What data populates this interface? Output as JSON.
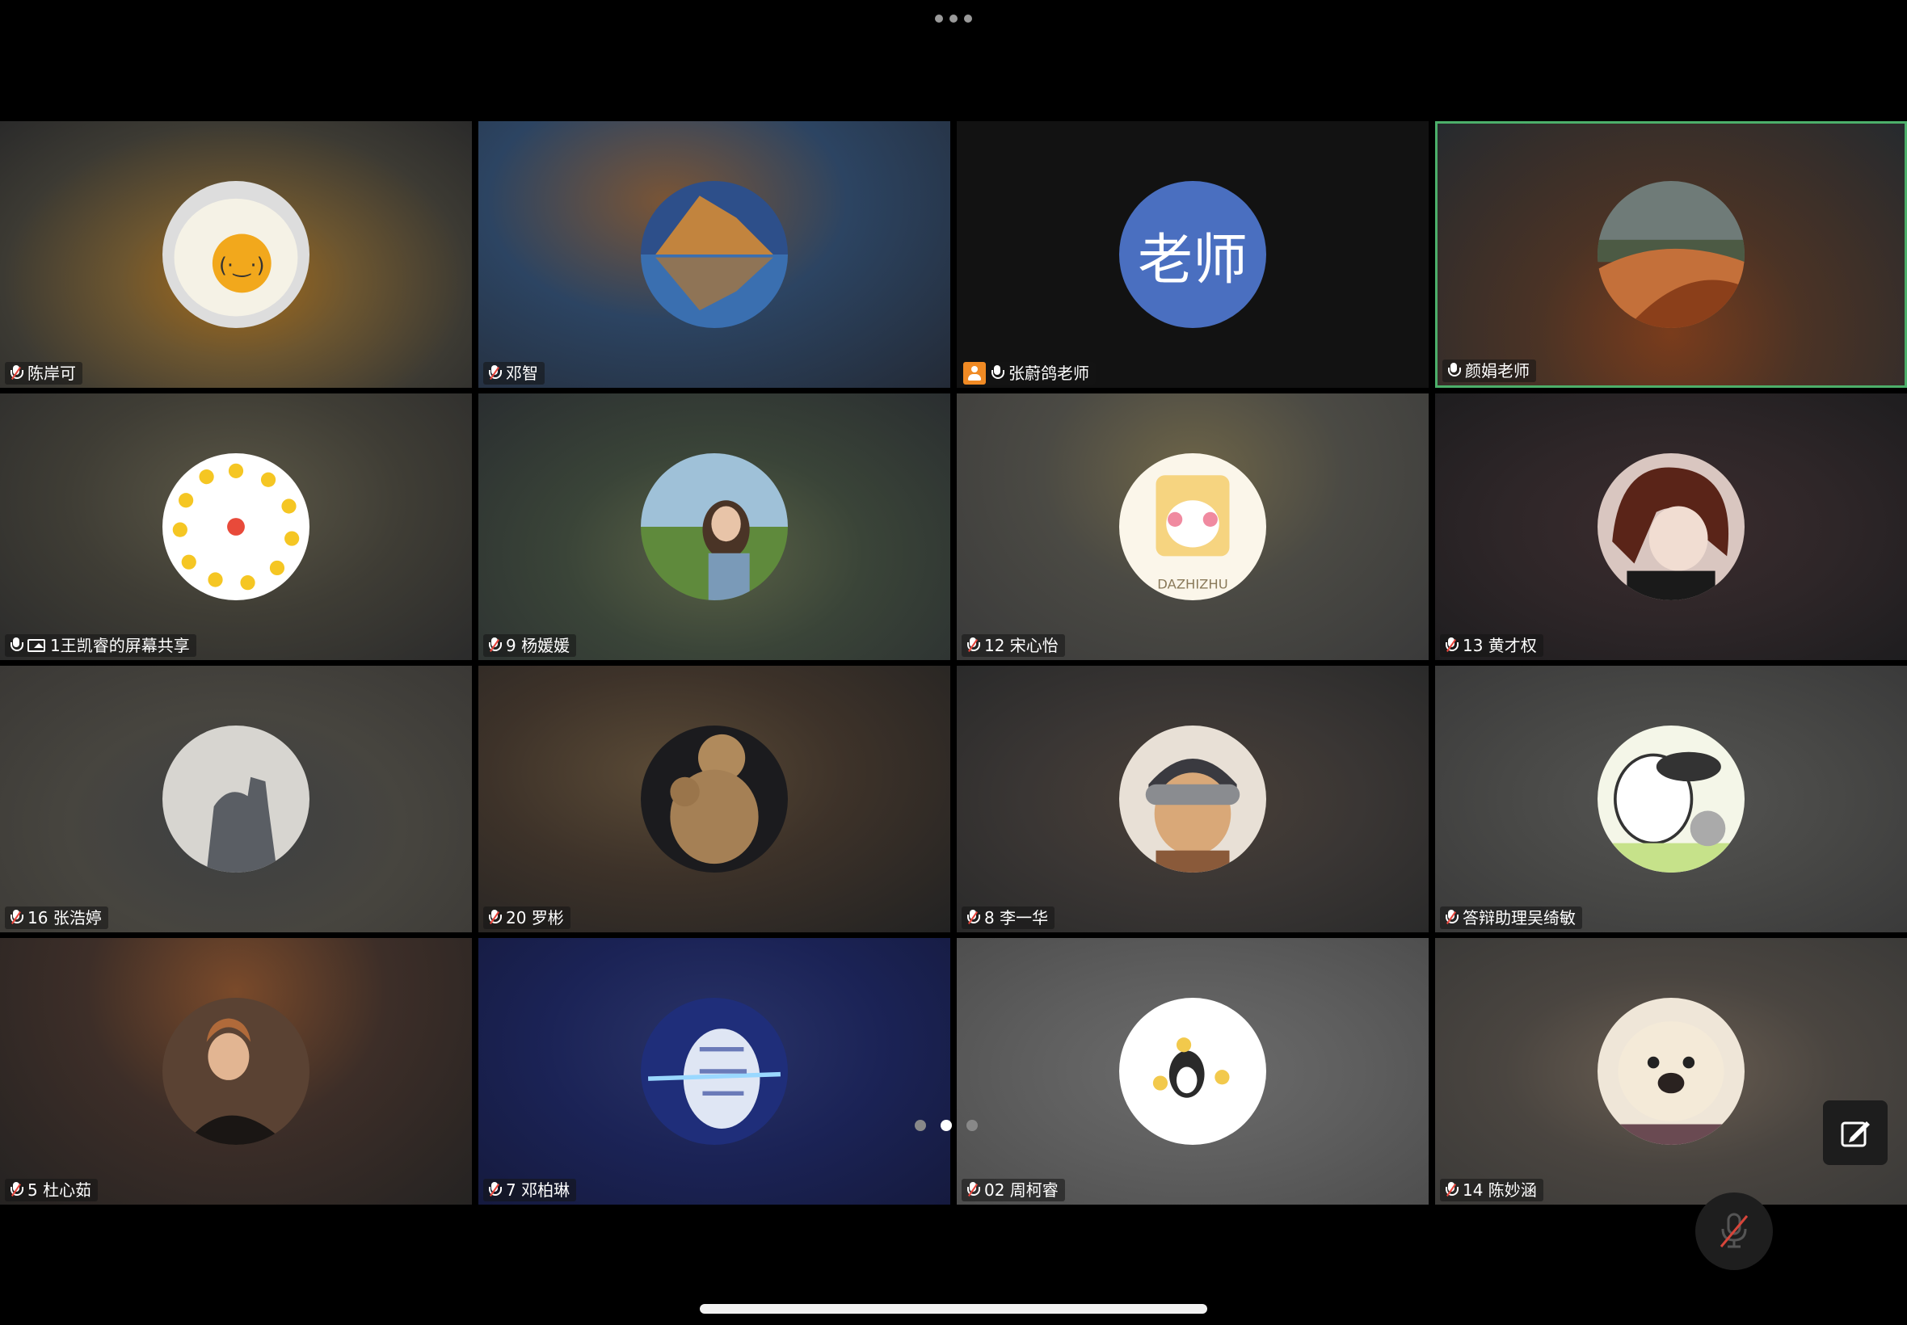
{
  "top_menu": {
    "icon": "more-dots-icon"
  },
  "colors": {
    "active_border": "#4caf6a",
    "muted_slash": "#e8453c",
    "host_badge": "#f08a24",
    "teacher_avatar": "#4a6fc0"
  },
  "participants": [
    {
      "name": "陈岸可",
      "mic": "muted",
      "avatar": "fried-egg-face"
    },
    {
      "name": "邓智",
      "mic": "muted",
      "avatar": "mountain-lake"
    },
    {
      "name": "张蔚鸽老师",
      "mic": "on",
      "host": true,
      "avatar_text": "老师"
    },
    {
      "name": "颜娟老师",
      "mic": "on",
      "active": true,
      "avatar": "desert-dunes"
    },
    {
      "name": "1王凯睿的屏幕共享",
      "mic": "on",
      "screen_share": true,
      "avatar": "emoji-circle"
    },
    {
      "name": "9 杨媛媛",
      "mic": "muted",
      "avatar": "girl-on-grassland"
    },
    {
      "name": "12 宋心怡",
      "mic": "muted",
      "avatar": "cartoon-bunny"
    },
    {
      "name": "13 黄才权",
      "mic": "muted",
      "avatar": "anime-girl"
    },
    {
      "name": "16 张浩婷",
      "mic": "muted",
      "avatar": "shadow-on-wall"
    },
    {
      "name": "20 罗彬",
      "mic": "muted",
      "avatar": "teddy-bear"
    },
    {
      "name": "8 李一华",
      "mic": "muted",
      "avatar": "anime-boy-goggles"
    },
    {
      "name": "答辩助理吴绮敏",
      "mic": "muted",
      "avatar": "white-dog-cartoon"
    },
    {
      "name": "5 杜心茹",
      "mic": "muted",
      "avatar": "woman-portrait"
    },
    {
      "name": "7 邓柏琳",
      "mic": "muted",
      "avatar": "blue-anime-scene"
    },
    {
      "name": "02 周柯睿",
      "mic": "muted",
      "avatar": "penguin-chicks"
    },
    {
      "name": "14 陈妙涵",
      "mic": "muted",
      "avatar": "puppy-face"
    }
  ],
  "pagination": {
    "pages": 3,
    "current": 2
  },
  "controls": {
    "edit_icon": "edit-icon",
    "mute_icon": "mic-muted-icon"
  }
}
